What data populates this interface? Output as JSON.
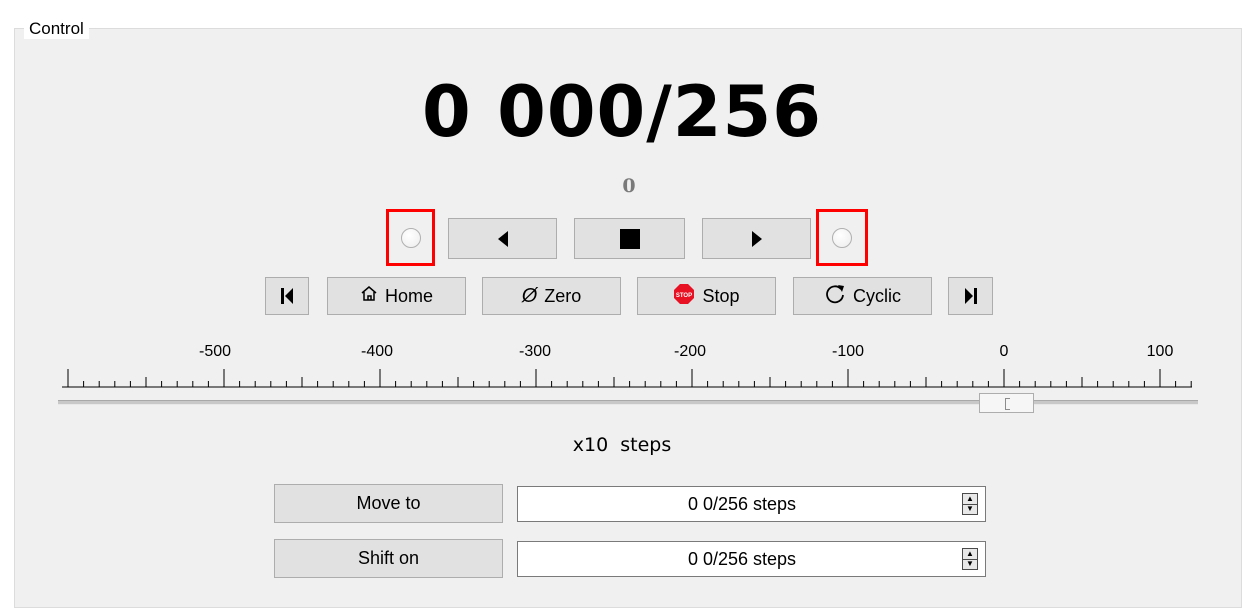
{
  "group": {
    "title": "Control"
  },
  "position": {
    "readout": "0 000/256",
    "sub": "0"
  },
  "transport": {
    "left_limit_icon": "led-indicator-icon",
    "reverse_icon": "play-left-icon",
    "stop_icon": "stop-square-icon",
    "forward_icon": "play-right-icon",
    "right_limit_icon": "led-indicator-icon"
  },
  "actions": {
    "go_start_icon": "skip-back-icon",
    "home_label": "Home",
    "home_icon": "home-icon",
    "zero_label": "Zero",
    "zero_icon": "zero-slash-icon",
    "stop_label": "Stop",
    "stop_icon": "stop-sign-icon",
    "stop_icon_text": "STOP",
    "cyclic_label": "Cyclic",
    "cyclic_icon": "refresh-icon",
    "go_end_icon": "skip-forward-icon"
  },
  "scale": {
    "tick_labels": [
      "-500",
      "-400",
      "-300",
      "-200",
      "-100",
      "0",
      "100"
    ],
    "units": "x10  steps"
  },
  "slider": {
    "value": 0,
    "min": -590,
    "max": 122
  },
  "move": {
    "move_to_label": "Move to",
    "move_to_value": "0 0/256 steps",
    "shift_on_label": "Shift on",
    "shift_on_value": "0 0/256 steps"
  },
  "colors": {
    "highlight": "#ff0000",
    "stop_red": "#e81123"
  }
}
